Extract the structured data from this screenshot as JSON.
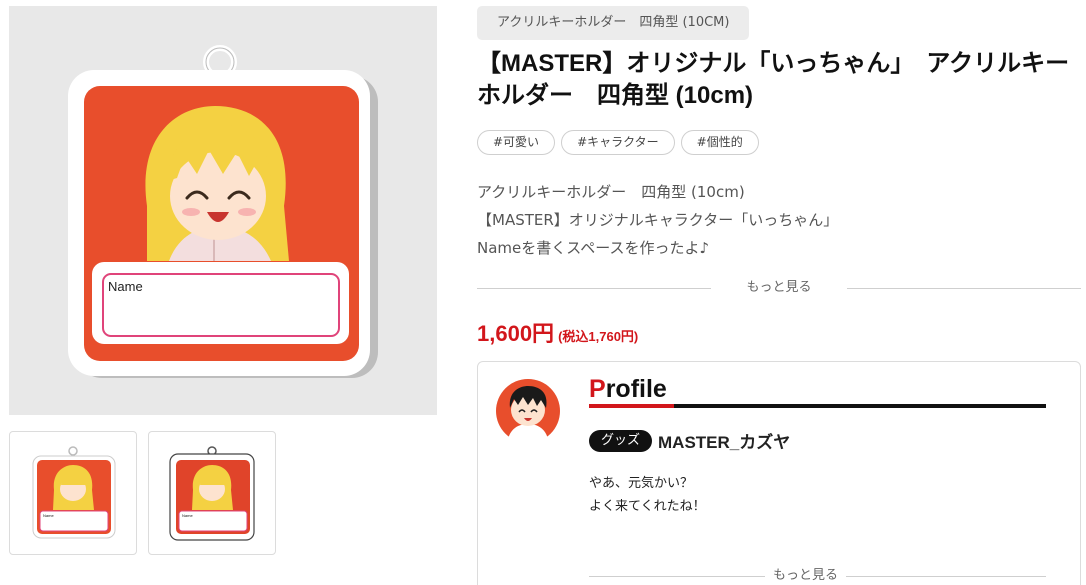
{
  "gallery": {
    "main_image": {
      "name_label": "Name",
      "colors": {
        "background": "#e8e8e8",
        "acrylic_red": "#e84e2c",
        "name_border": "#e0447a",
        "hair": "#f4d142"
      }
    },
    "thumbnails": [
      {
        "name_label": "Name"
      },
      {
        "name_label": "Name"
      }
    ]
  },
  "product": {
    "category": "アクリルキーホルダー　四角型 (10CM)",
    "title": "【MASTER】オリジナル「いっちゃん」　アクリルキーホルダー　四角型 (10cm)",
    "tags": [
      "#可愛い",
      "#キャラクター",
      "#個性的"
    ],
    "description_lines": [
      "アクリルキーホルダー　四角型 (10cm)",
      "【MASTER】オリジナルキャラクター「いっちゃん」",
      "Nameを書くスペースを作ったよ♪"
    ],
    "more_label": "もっと見る",
    "price": "1,600円",
    "price_tax": "(税込1,760円)",
    "price_color": "#d2161b"
  },
  "profile": {
    "heading_first": "P",
    "heading_rest": "rofile",
    "badge": "グッズ",
    "shop_name": "MASTER_カズヤ",
    "text_lines": [
      "やあ、元気かい？",
      "よく来てくれたね！"
    ],
    "more_label": "もっと見る"
  }
}
